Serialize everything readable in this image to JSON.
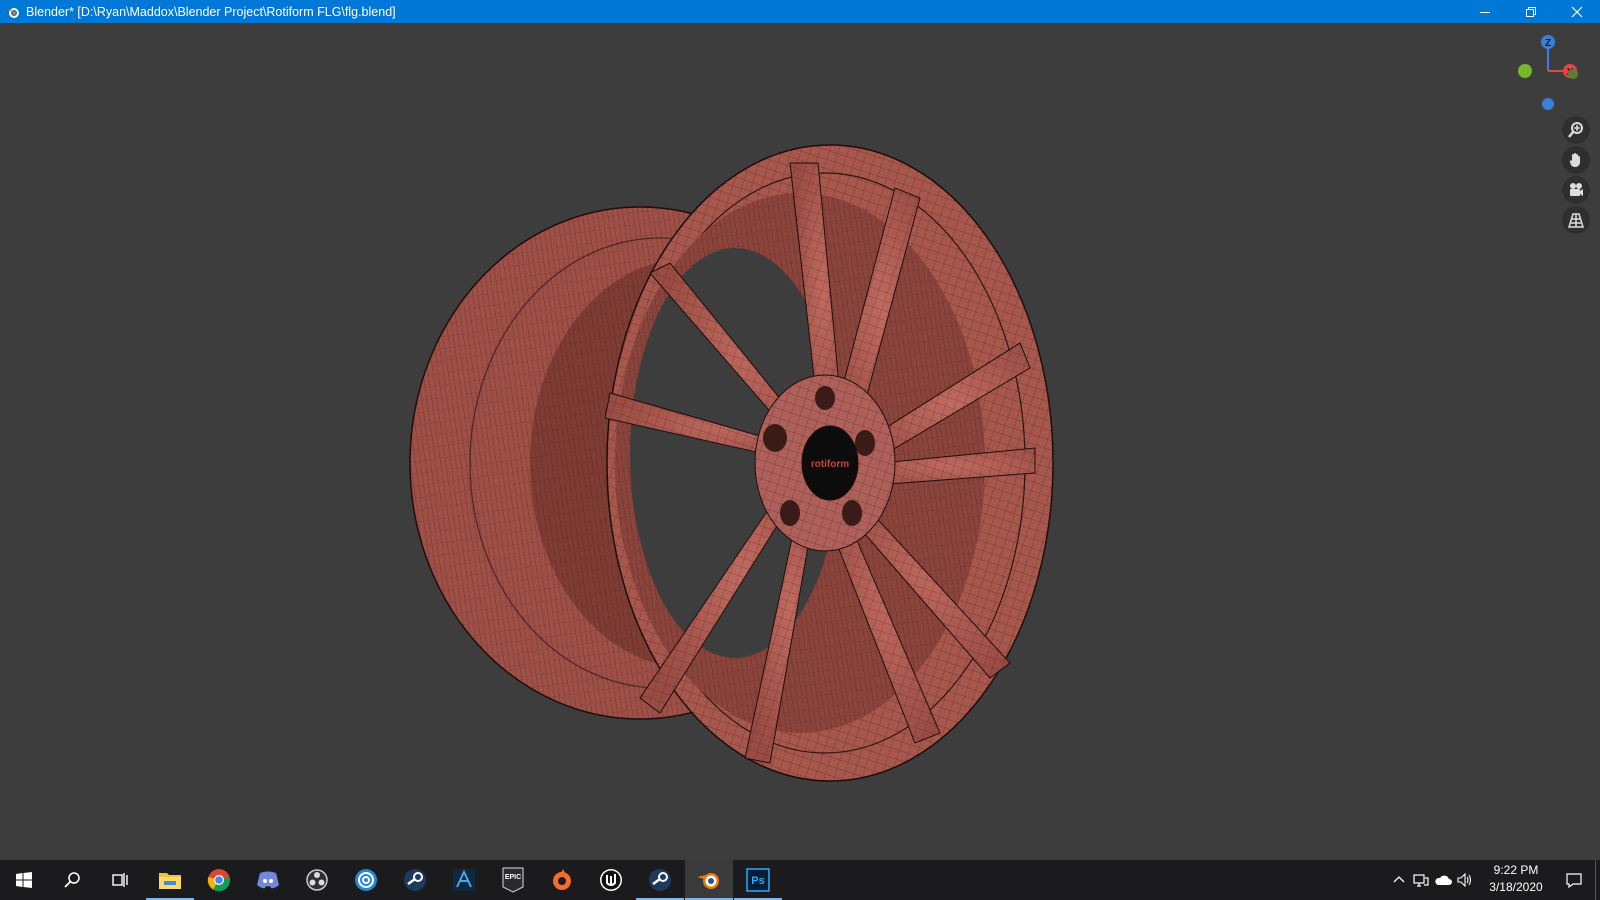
{
  "window": {
    "title": "Blender* [D:\\Ryan\\Maddox\\Blender Project\\Rotiform FLG\\flg.blend]",
    "app_icon": "blender-icon",
    "controls": [
      "minimize-icon",
      "restore-icon",
      "close-icon"
    ]
  },
  "viewport": {
    "background": "#3d3d3d",
    "model_color": "#a9594f",
    "center_cap_text": "rotiform",
    "gizmo": {
      "z_label": "Z",
      "x_label": "X",
      "x_color": "#e8434b",
      "y_color": "#77b82a",
      "z_color": "#3a7fd9"
    },
    "nav_buttons": [
      "zoom-icon",
      "hand-pan-icon",
      "camera-icon",
      "grid-perspective-icon"
    ]
  },
  "taskbar": {
    "apps": [
      "start-icon",
      "search-icon",
      "task-view-icon",
      "file-explorer-icon",
      "chrome-icon",
      "discord-icon",
      "obs-icon",
      "uplay-icon",
      "steam-icon",
      "autodesk-icon",
      "epic-games-icon",
      "origin-icon",
      "unreal-engine-icon",
      "steam-icon-2",
      "blender-icon",
      "photoshop-icon"
    ],
    "epic_label": "EPIC",
    "ps_label": "Ps",
    "time": "9:22 PM",
    "date": "3/18/2020"
  }
}
